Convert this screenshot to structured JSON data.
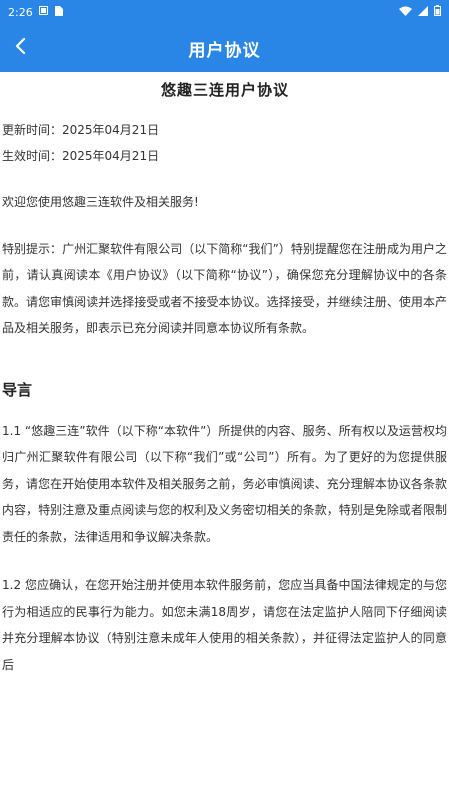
{
  "status_bar": {
    "time": "2:26",
    "left_icons": [
      "notification-icon",
      "sim-icon"
    ],
    "right_icons": [
      "wifi-icon",
      "signal-icon",
      "battery-icon"
    ]
  },
  "app_bar": {
    "title": "用户协议"
  },
  "document": {
    "title": "悠趣三连用户协议",
    "updated": "更新时间：2025年04月21日",
    "effective": "生效时间：2025年04月21日",
    "welcome": "欢迎您使用悠趣三连软件及相关服务!",
    "notice": "特别提示：广州汇聚软件有限公司（以下简称“我们”）特别提醒您在注册成为用户之前，请认真阅读本《用户协议》（以下简称“协议”），确保您充分理解协议中的各条款。请您审慎阅读并选择接受或者不接受本协议。选择接受，并继续注册、使用本产品及相关服务，即表示已充分阅读并同意本协议所有条款。",
    "section_heading": "导言",
    "p1_1": "1.1 “悠趣三连”软件（以下称“本软件”）所提供的内容、服务、所有权以及运营权均归广州汇聚软件有限公司（以下称“我们”或“公司”）所有。为了更好的为您提供服务，请您在开始使用本软件及相关服务之前，务必审慎阅读、充分理解本协议各条款内容，特别注意及重点阅读与您的权利及义务密切相关的条款，特别是免除或者限制责任的条款，法律适用和争议解决条款。",
    "p1_2": "1.2 您应确认，在您开始注册并使用本软件服务前，您应当具备中国法律规定的与您行为相适应的民事行为能力。如您未满18周岁，请您在法定监护人陪同下仔细阅读并充分理解本协议（特别注意未成年人使用的相关条款），并征得法定监护人的同意后"
  },
  "colors": {
    "primary": "#2a86e6",
    "text": "#333333"
  }
}
